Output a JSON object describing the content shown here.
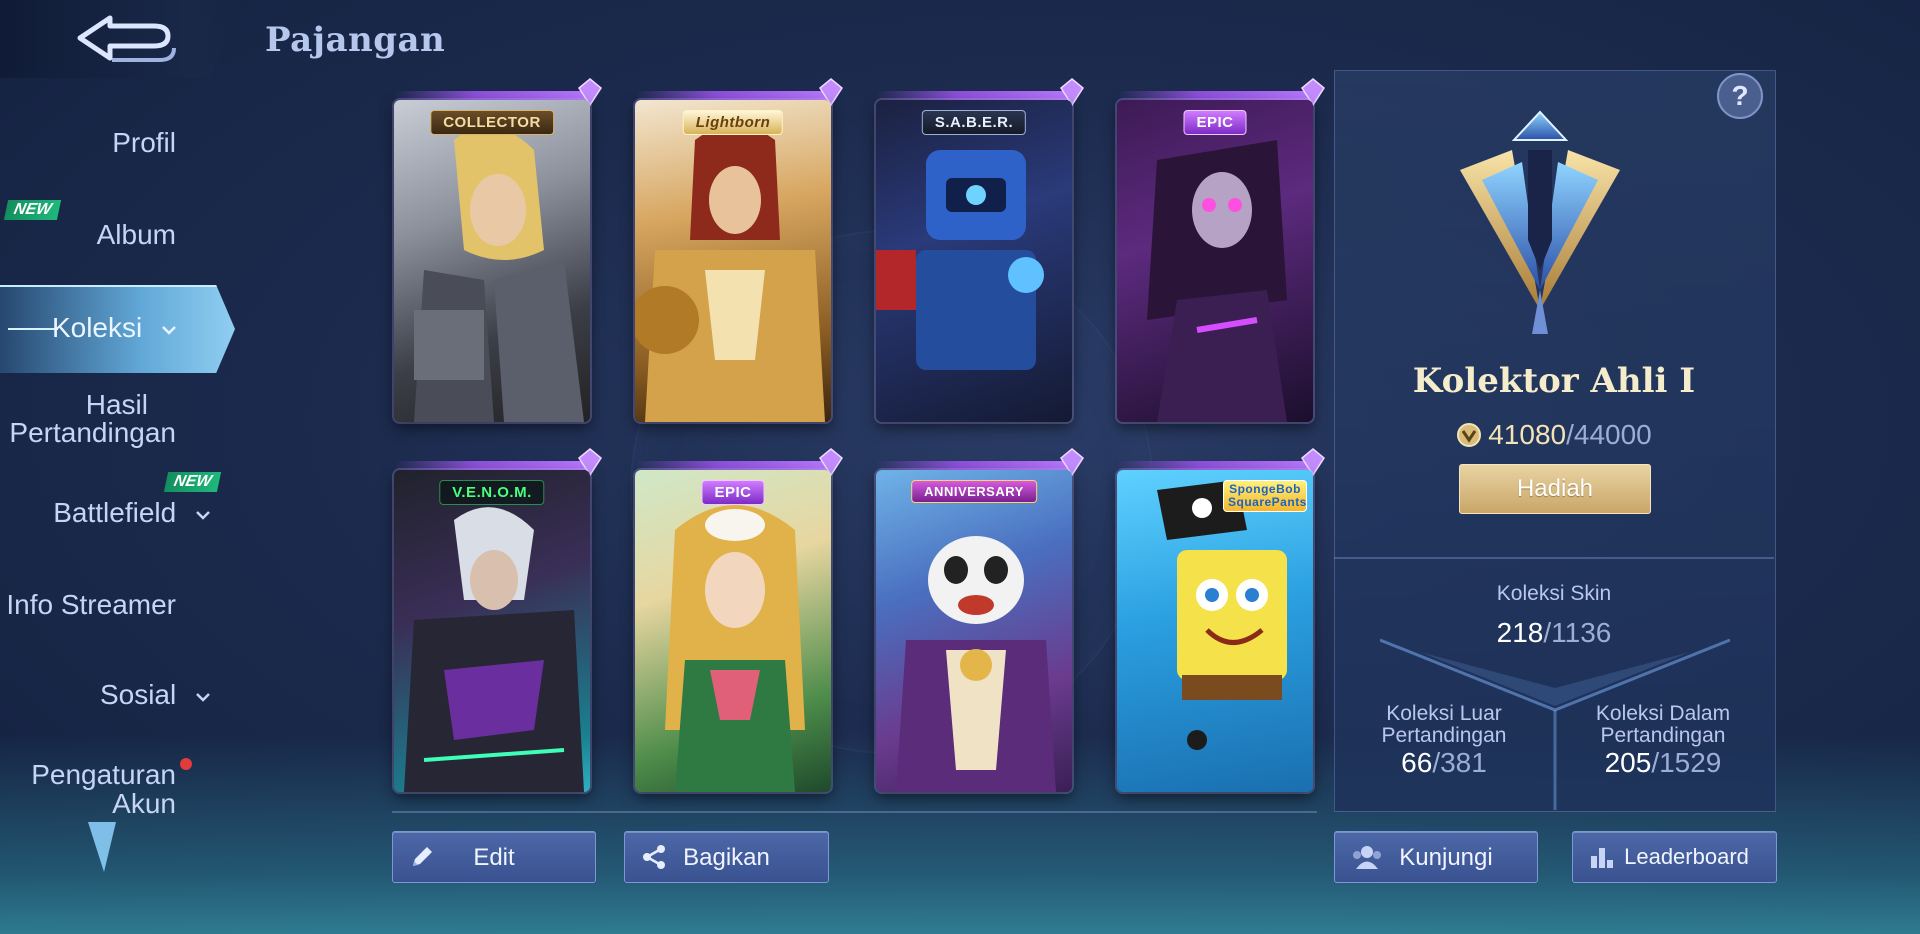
{
  "header": {
    "title": "Pajangan"
  },
  "sidebar": {
    "items": [
      {
        "label": "Profil"
      },
      {
        "label": "Album",
        "badge": "NEW"
      },
      {
        "label": "Koleksi",
        "active": true
      },
      {
        "label_line1": "Hasil",
        "label_line2": "Pertandingan"
      },
      {
        "label": "Battlefield",
        "badge": "NEW"
      },
      {
        "label": "Info Streamer"
      },
      {
        "label": "Sosial"
      },
      {
        "label_line1": "Pengaturan",
        "label_line2": "Akun"
      }
    ]
  },
  "showcase": {
    "cards": [
      {
        "badge": "COLLECTOR",
        "character": "armored blonde heroine"
      },
      {
        "badge": "Lightborn",
        "character": "golden armored knight"
      },
      {
        "badge": "S.A.B.E.R.",
        "character": "blue mech robot"
      },
      {
        "badge": "EPIC",
        "character": "dark purple masked figure"
      },
      {
        "badge": "V.E.N.O.M.",
        "character": "silver haired armored hero"
      },
      {
        "badge": "EPIC",
        "character": "blonde forest fairy"
      },
      {
        "badge": "ANNIVERSARY",
        "character": "panda brawler"
      },
      {
        "badge": "SpongeBob SquarePants",
        "character": "pirate sponge"
      }
    ]
  },
  "actions": {
    "edit": "Edit",
    "share": "Bagikan",
    "visit": "Kunjungi",
    "leaderboard": "Leaderboard"
  },
  "rank_panel": {
    "help": "?",
    "rank_name": "Kolektor Ahli I",
    "points_current": "41080",
    "points_max": "/44000",
    "reward_button": "Hadiah",
    "skin_collection": {
      "label": "Koleksi Skin",
      "current": "218",
      "max": "/1136"
    },
    "outside_match": {
      "label_line1": "Koleksi Luar",
      "label_line2": "Pertandingan",
      "current": "66",
      "max": "/381"
    },
    "inside_match": {
      "label_line1": "Koleksi Dalam",
      "label_line2": "Pertandingan",
      "current": "205",
      "max": "/1529"
    }
  },
  "colors": {
    "accent_gold": "#e9d3a2",
    "rare_purple": "#9b59e6",
    "new_badge": "#1fb87a"
  }
}
